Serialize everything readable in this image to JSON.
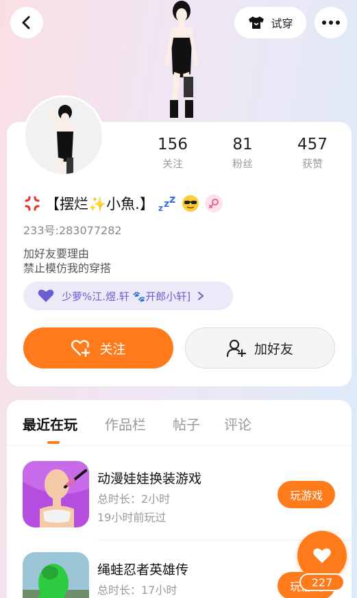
{
  "topbar": {
    "tryon_label": "试穿"
  },
  "stats": [
    {
      "value": "156",
      "label": "关注"
    },
    {
      "value": "81",
      "label": "粉丝"
    },
    {
      "value": "457",
      "label": "获赞"
    }
  ],
  "profile": {
    "name": "【摆烂✨小魚.】",
    "uid_label": "233号:",
    "uid": "283077282",
    "bio_lines": [
      "加好友要理由",
      "禁止模仿我的穿搭"
    ],
    "relation_text": "少萝%江.煜.轩 🐾开郎小轩]"
  },
  "actions": {
    "follow": "关注",
    "add_friend": "加好友"
  },
  "tabs": [
    "最近在玩",
    "作品栏",
    "帖子",
    "评论"
  ],
  "games": [
    {
      "title": "动漫娃娃换装游戏",
      "duration": "总时长：2小时",
      "last_played": "19小时前玩过",
      "play_label": "玩游戏"
    },
    {
      "title": "绳蛙忍者英雄传",
      "duration": "总时长：17小时",
      "play_label": "玩游戏"
    }
  ],
  "likes": {
    "count": "227"
  },
  "colors": {
    "accent": "#ff7a1a",
    "relation": "#6a5fcf"
  }
}
